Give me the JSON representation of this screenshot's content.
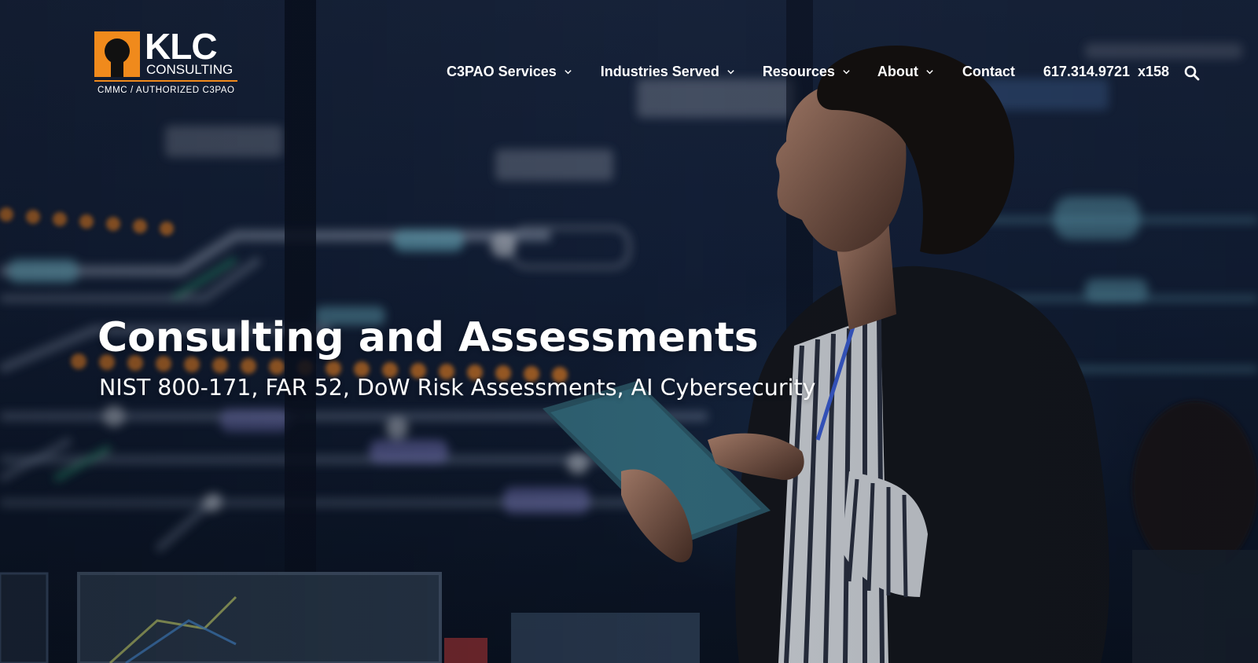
{
  "brand": {
    "name": "KLC",
    "subname": "CONSULTING",
    "tagline": "CMMC / AUTHORIZED C3PAO",
    "accent_color": "#f08a1c"
  },
  "nav": {
    "items": [
      {
        "label": "C3PAO Services",
        "has_dropdown": true,
        "icon": "chevron-down-icon"
      },
      {
        "label": "Industries Served",
        "has_dropdown": true,
        "icon": "chevron-down-icon"
      },
      {
        "label": "Resources",
        "has_dropdown": true,
        "icon": "chevron-down-icon"
      },
      {
        "label": "About",
        "has_dropdown": true,
        "icon": "chevron-down-icon"
      },
      {
        "label": "Contact",
        "has_dropdown": false
      }
    ],
    "phone": "617.314.9721  x158",
    "search_icon": "search-icon"
  },
  "hero": {
    "title": "Consulting and Assessments",
    "subtitle": "NIST 800-171, FAR 52, DoW Risk Assessments, AI Cybersecurity"
  }
}
